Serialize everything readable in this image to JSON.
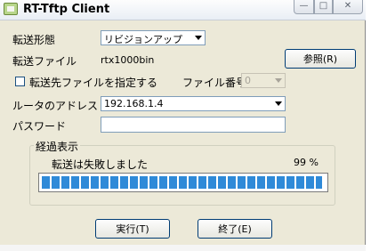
{
  "window": {
    "title": "RT-Tftp Client",
    "controls": {
      "minimize": "—",
      "maximize": "□",
      "close": "✕"
    }
  },
  "form": {
    "transfer_mode_label": "転送形態",
    "transfer_mode_value": "リビジョンアップ",
    "transfer_file_label": "転送ファイル",
    "transfer_file_value": "rtx1000bin",
    "browse_button": "参照(R)",
    "dest_checkbox_label": "転送先ファイルを指定する",
    "dest_checkbox_checked": false,
    "file_number_label": "ファイル番号:",
    "file_number_value": "0",
    "router_address_label": "ルータのアドレス",
    "router_address_value": "192.168.1.4",
    "password_label": "パスワード",
    "password_value": ""
  },
  "progress": {
    "group_title": "経過表示",
    "status_text": "転送は失敗しました",
    "percent_text": "99 %",
    "percent_value": 99
  },
  "buttons": {
    "run": "実行(T)",
    "exit": "終了(E)"
  },
  "colors": {
    "window_bg": "#ece9d8",
    "progress_segment": "#2f8ad8"
  }
}
